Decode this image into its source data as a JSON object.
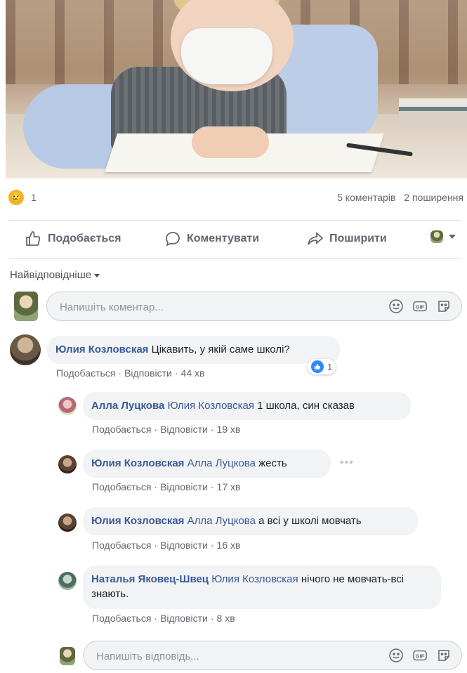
{
  "post": {
    "reaction_count": "1",
    "comments_count": "5 коментарів",
    "shares_count": "2 поширення"
  },
  "actions": {
    "like": "Подобається",
    "comment": "Коментувати",
    "share": "Поширити"
  },
  "sort_label": "Найвідповідніше",
  "comment_input": {
    "placeholder": "Напишіть коментар..."
  },
  "reply_input": {
    "placeholder": "Напишіть відповідь..."
  },
  "meta_labels": {
    "like": "Подобається",
    "reply": "Відповісти",
    "sep": "·"
  },
  "comments": [
    {
      "author": "Юлия Козловская",
      "mention": "",
      "text": "Цікавить, у якій саме школі?",
      "time": "44 хв",
      "likes": "1"
    },
    {
      "author": "Алла Луцкова",
      "mention": "Юлия Козловская",
      "text": "1 школа, син сказав",
      "time": "19 хв"
    },
    {
      "author": "Юлия Козловская",
      "mention": "Алла Луцкова",
      "text": "жесть",
      "time": "17 хв"
    },
    {
      "author": "Юлия Козловская",
      "mention": "Алла Луцкова",
      "text": "а всі у школі мовчать",
      "time": "16 хв"
    },
    {
      "author": "Наталья Яковец-Швец",
      "mention": "Юлия Козловская",
      "text": "нічого не мовчать-всі знають.",
      "time": "8 хв"
    }
  ],
  "colors": {
    "link_blue": "#385898",
    "like_blue": "#2d88ff",
    "muted": "#606770"
  }
}
